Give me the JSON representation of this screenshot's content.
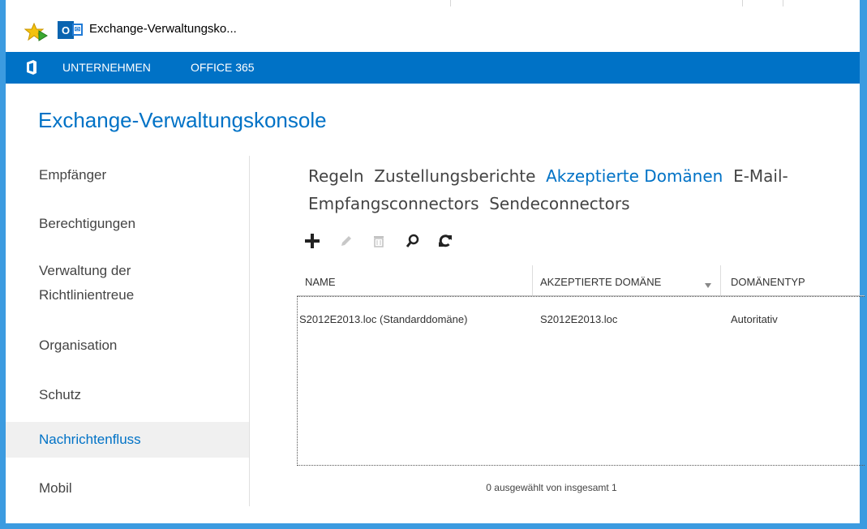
{
  "window": {
    "tab_title": "Exchange-Verwaltungsko..."
  },
  "topbar": {
    "nav": [
      "UNTERNEHMEN",
      "OFFICE 365"
    ]
  },
  "page": {
    "title": "Exchange-Verwaltungskonsole"
  },
  "sidebar": {
    "items": [
      {
        "label": "Empfänger"
      },
      {
        "label": "Berechtigungen"
      },
      {
        "label": "Verwaltung der"
      },
      {
        "label": "Richtlinientreue"
      },
      {
        "label": "Organisation"
      },
      {
        "label": "Schutz"
      },
      {
        "label": "Nachrichtenfluss",
        "selected": true
      },
      {
        "label": "Mobil"
      }
    ]
  },
  "subnav": {
    "tabs": [
      {
        "label": "Regeln"
      },
      {
        "label": "Zustellungsberichte"
      },
      {
        "label": "Akzeptierte Domänen",
        "active": true
      },
      {
        "label": "E-Mail-"
      },
      {
        "label": "Empfangsconnectors"
      },
      {
        "label": "Sendeconnectors"
      }
    ]
  },
  "toolbar": {
    "buttons": [
      "add-icon",
      "edit-icon",
      "delete-icon",
      "search-icon",
      "refresh-icon"
    ]
  },
  "grid": {
    "columns": [
      "NAME",
      "AKZEPTIERTE DOMÄNE",
      "DOMÄNENTYP"
    ],
    "sort_column": "AKZEPTIERTE DOMÄNE",
    "rows": [
      [
        "S2012E2013.loc (Standarddomäne)",
        "S2012E2013.loc",
        "Autoritativ"
      ]
    ]
  },
  "status": {
    "text": "0 ausgewählt von insgesamt 1"
  },
  "colors": {
    "accent": "#0072c6",
    "frame": "#3c9be0"
  }
}
